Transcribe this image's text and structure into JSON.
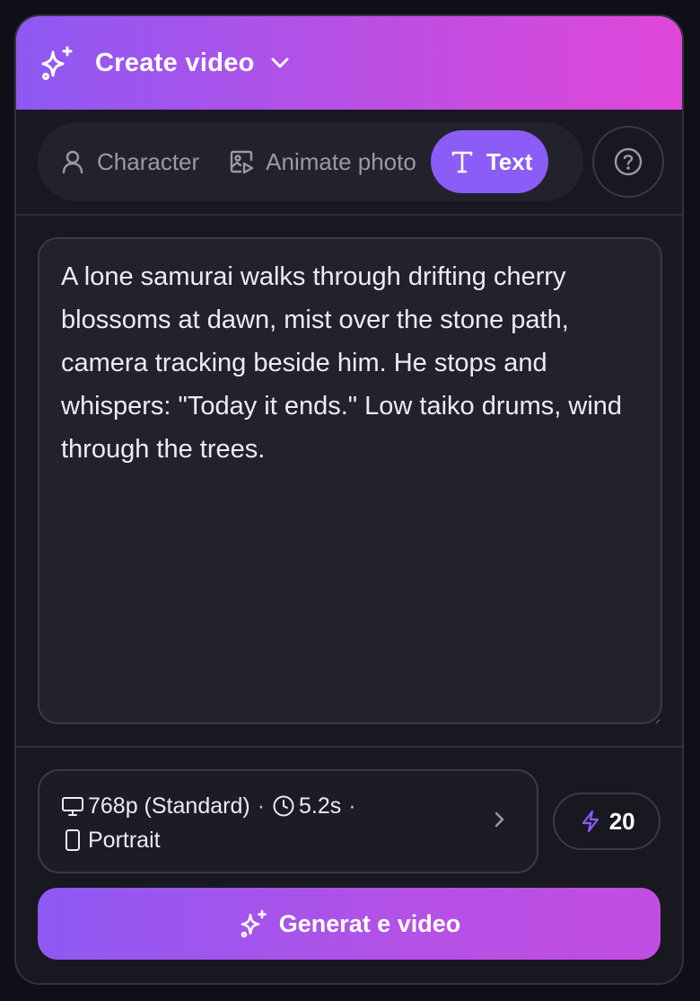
{
  "header": {
    "title": "Create video",
    "icon": "sparkles-icon",
    "dropdown_icon": "chevron-down-icon"
  },
  "tabs": [
    {
      "label": "Character",
      "icon": "user-icon",
      "active": false
    },
    {
      "label": "Animate photo",
      "icon": "image-play-icon",
      "active": false
    },
    {
      "label": "Text",
      "icon": "text-type-icon",
      "active": true
    }
  ],
  "help_icon": "help-circle-icon",
  "prompt": {
    "value": "A lone samurai walks through drifting cherry blossoms at dawn, mist over the stone path, camera tracking beside him. He stops and whispers: \"Today it ends.\" Low taiko drums, wind through the trees."
  },
  "settings": {
    "resolution": "768p (Standard)",
    "duration": "5.2s",
    "aspect": "Portrait",
    "separator": "·"
  },
  "credits": {
    "value": "20",
    "icon": "zap-icon"
  },
  "generate": {
    "label": "Generat e video",
    "icon": "sparkles-icon"
  },
  "colors": {
    "accent": "#8b5cf6",
    "gradient_start": "#8e59f3",
    "gradient_end": "#e047d9",
    "background": "#181821"
  }
}
